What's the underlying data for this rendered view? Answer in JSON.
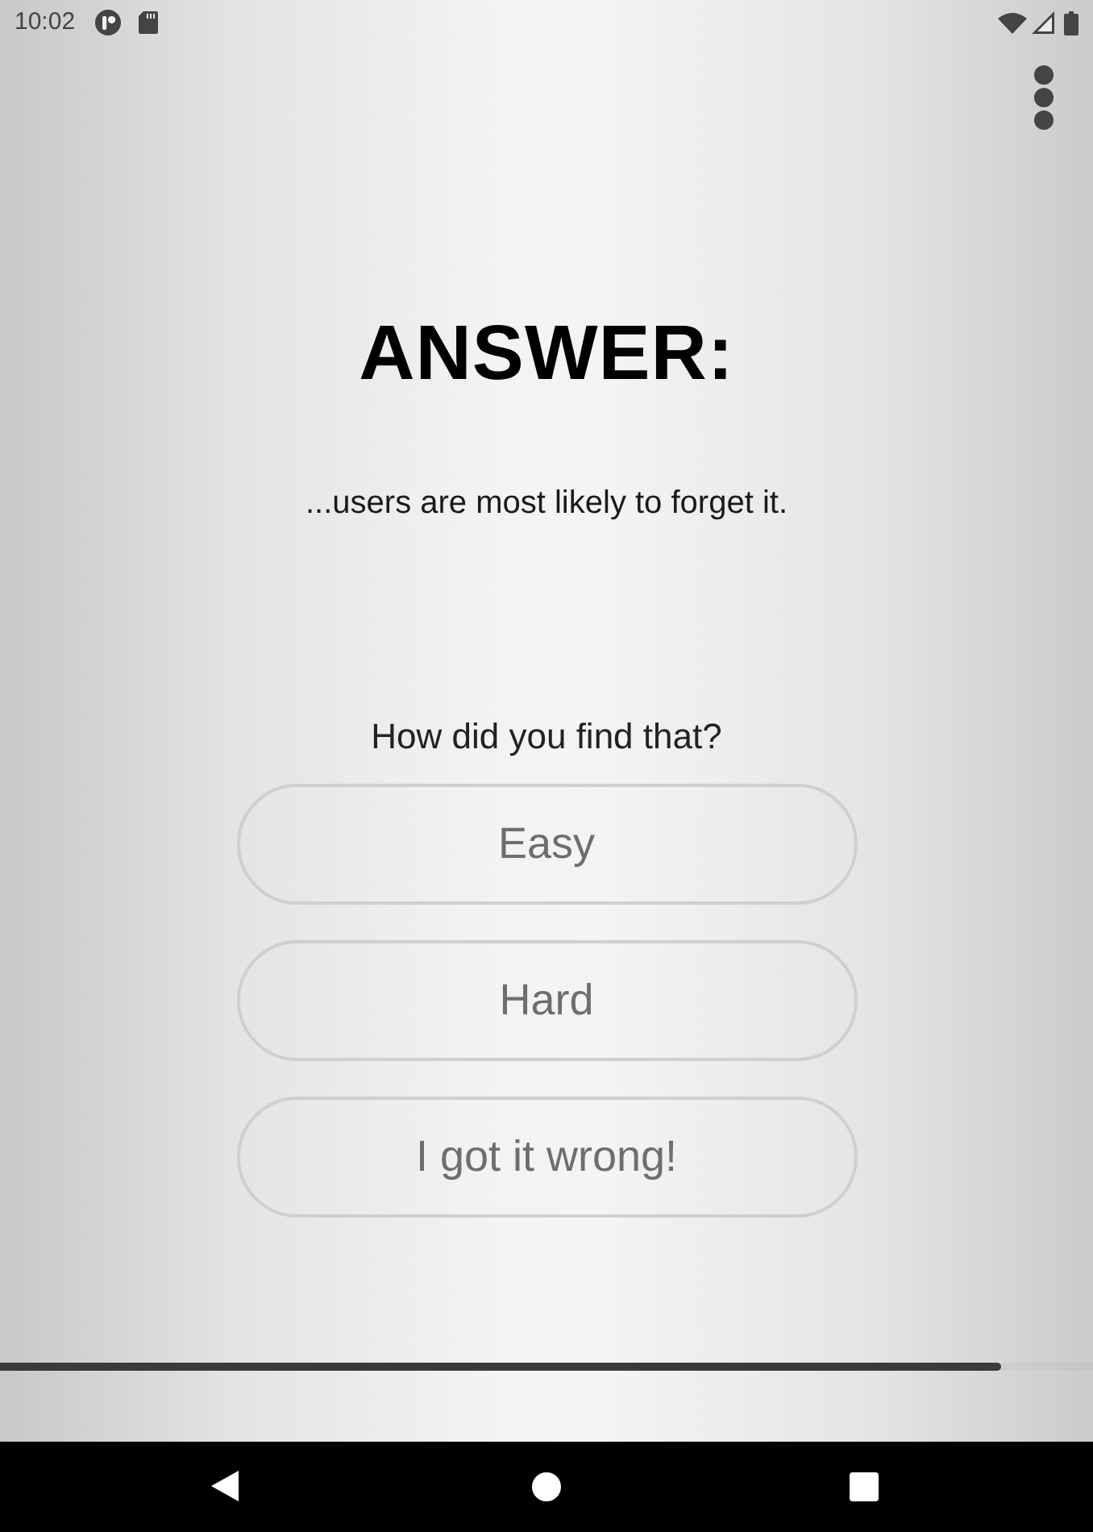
{
  "status_bar": {
    "time": "10:02"
  },
  "title": "ANSWER:",
  "answer": "...users are most likely to forget it.",
  "prompt": "How did you find that?",
  "buttons": [
    {
      "label": "Easy"
    },
    {
      "label": "Hard"
    },
    {
      "label": "I got it wrong!"
    }
  ],
  "progress": {
    "level": 0.916
  }
}
